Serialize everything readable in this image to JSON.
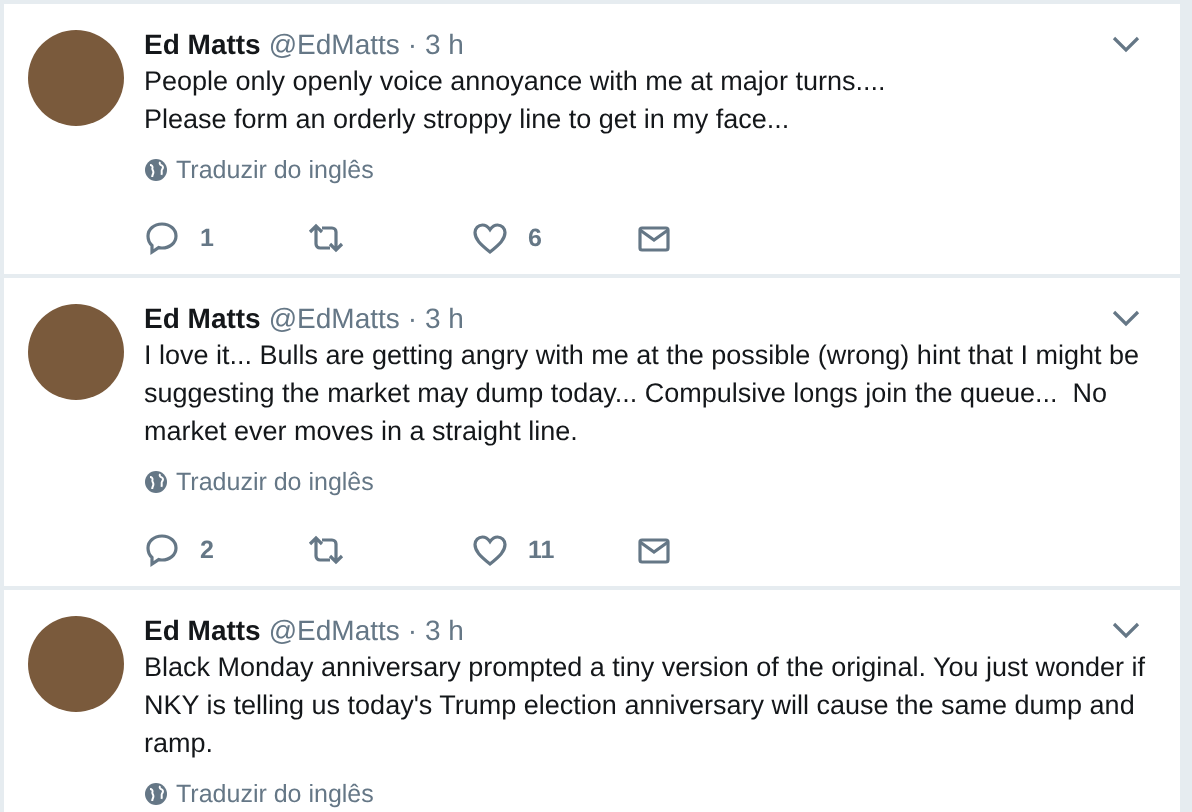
{
  "tweets": [
    {
      "name": "Ed Matts",
      "handle": "@EdMatts",
      "time": "· 3 h",
      "text": "People only openly voice annoyance with me at major turns....\nPlease form an orderly stroppy line to get in my face...",
      "translate": "Traduzir do inglês",
      "actions": {
        "replies": "1",
        "likes": "6"
      }
    },
    {
      "name": "Ed Matts",
      "handle": "@EdMatts",
      "time": "· 3 h",
      "text": "I love it... Bulls are getting angry with me at the possible (wrong) hint that I might be suggesting the market may dump today... Compulsive longs join the queue...  No market ever moves in a straight line.",
      "translate": "Traduzir do inglês",
      "actions": {
        "replies": "2",
        "likes": "11"
      }
    },
    {
      "name": "Ed Matts",
      "handle": "@EdMatts",
      "time": "· 3 h",
      "text": "Black Monday anniversary prompted a tiny version of the original. You just wonder if NKY is telling us today's Trump election anniversary will cause the same dump and ramp.",
      "translate": "Traduzir do inglês"
    }
  ]
}
